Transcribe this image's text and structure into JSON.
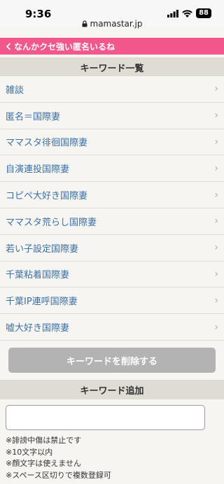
{
  "status_bar": {
    "time": "9:36",
    "battery": "88"
  },
  "url_bar": {
    "domain": "mamastar.jp"
  },
  "nav": {
    "back_label": "なんかクセ強い匿名いるね"
  },
  "keyword_list_header": "キーワード一覧",
  "keywords": [
    "雑談",
    "匿名＝国際妻",
    "ママスタ徘徊国際妻",
    "自演連投国際妻",
    "コピペ大好き国際妻",
    "ママスタ荒らし国際妻",
    "若い子設定国際妻",
    "千葉粘着国際妻",
    "千葉IP連呼国際妻",
    "嘘大好き国際妻"
  ],
  "delete_button_label": "キーワードを削除する",
  "add_keyword_header": "キーワード追加",
  "add_input": {
    "value": "",
    "placeholder": ""
  },
  "notes": [
    "※誹謗中傷は禁止です",
    "※10文字以内",
    "※顔文字は使えません",
    "※スペース区切りで複数登録可"
  ],
  "colors": {
    "nav_pink": "#f2578c",
    "link_blue": "#3a6fa8",
    "header_beige": "#dfdcd3",
    "disabled_button": "#b3b3b3"
  }
}
